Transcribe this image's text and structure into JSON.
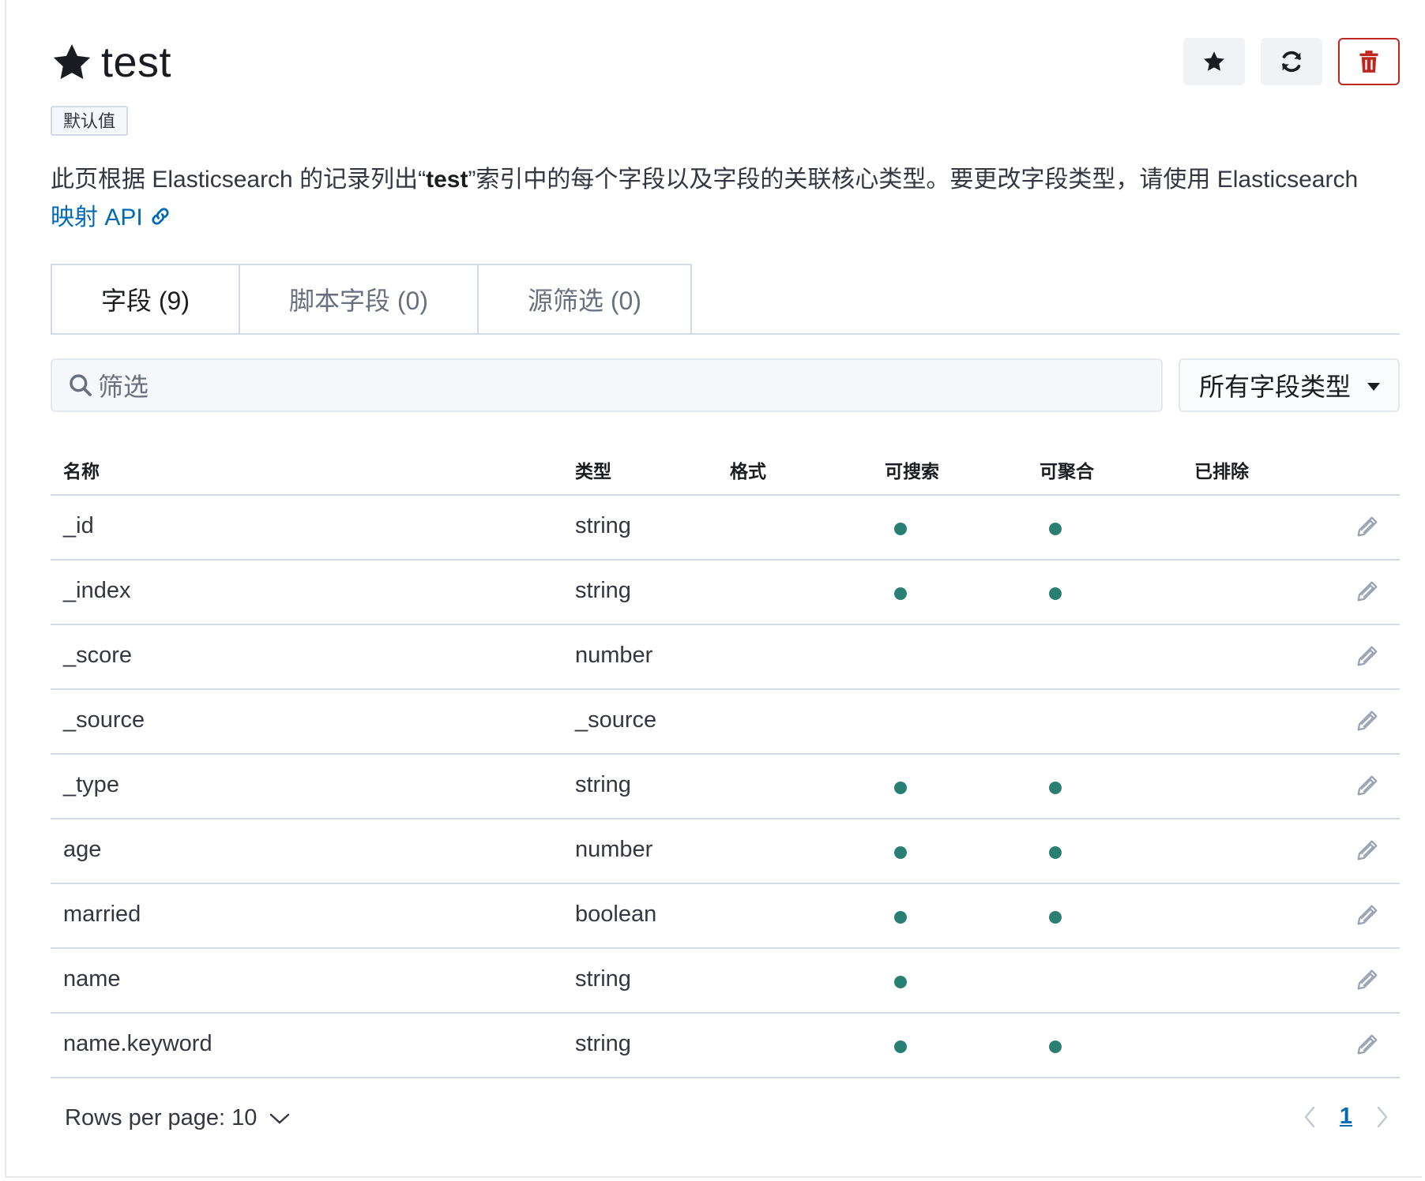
{
  "header": {
    "title": "test",
    "badge": "默认值"
  },
  "description": {
    "before": "此页根据 Elasticsearch 的记录列出“",
    "index_name": "test",
    "after": "”索引中的每个字段以及字段的关联核心类型。要更改字段类型，请使用 Elasticsearch ",
    "link_text": "映射 API"
  },
  "tabs": [
    {
      "label": "字段 (9)",
      "active": true
    },
    {
      "label": "脚本字段 (0)",
      "active": false
    },
    {
      "label": "源筛选 (0)",
      "active": false
    }
  ],
  "filter": {
    "placeholder": "筛选",
    "type_select": "所有字段类型"
  },
  "table": {
    "columns": [
      "名称",
      "类型",
      "格式",
      "可搜索",
      "可聚合",
      "已排除"
    ],
    "rows": [
      {
        "name": "_id",
        "type": "string",
        "searchable": true,
        "aggregatable": true
      },
      {
        "name": "_index",
        "type": "string",
        "searchable": true,
        "aggregatable": true
      },
      {
        "name": "_score",
        "type": "number",
        "searchable": false,
        "aggregatable": false
      },
      {
        "name": "_source",
        "type": "_source",
        "searchable": false,
        "aggregatable": false
      },
      {
        "name": "_type",
        "type": "string",
        "searchable": true,
        "aggregatable": true
      },
      {
        "name": "age",
        "type": "number",
        "searchable": true,
        "aggregatable": true
      },
      {
        "name": "married",
        "type": "boolean",
        "searchable": true,
        "aggregatable": true
      },
      {
        "name": "name",
        "type": "string",
        "searchable": true,
        "aggregatable": false
      },
      {
        "name": "name.keyword",
        "type": "string",
        "searchable": true,
        "aggregatable": true
      }
    ]
  },
  "pagination": {
    "rows_per_page": "Rows per page: 10",
    "current_page": "1"
  },
  "colors": {
    "dot": "#2a7f73",
    "link": "#006bb4",
    "danger": "#bd271e"
  }
}
